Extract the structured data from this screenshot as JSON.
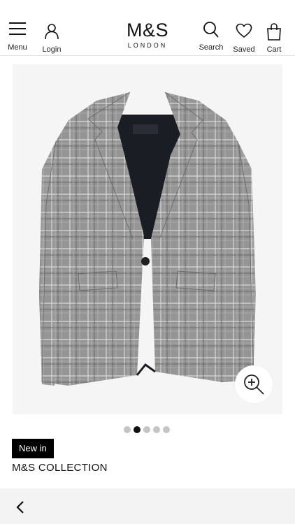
{
  "header": {
    "menu_label": "Menu",
    "login_label": "Login",
    "logo_main": "M&S",
    "logo_sub": "LONDON",
    "search_label": "Search",
    "saved_label": "Saved",
    "cart_label": "Cart"
  },
  "gallery": {
    "slide_count": 5,
    "active_index": 1,
    "zoom_icon": "zoom-in-icon"
  },
  "product": {
    "badge": "New in",
    "brand": "M&S COLLECTION"
  },
  "footer": {
    "back_icon": "chevron-left-icon"
  },
  "colors": {
    "accent": "#000000",
    "image_bg": "#f5f5f6",
    "footer_bg": "#f3f3f3",
    "dot_inactive": "#c4c4c4",
    "dot_active": "#111111"
  }
}
